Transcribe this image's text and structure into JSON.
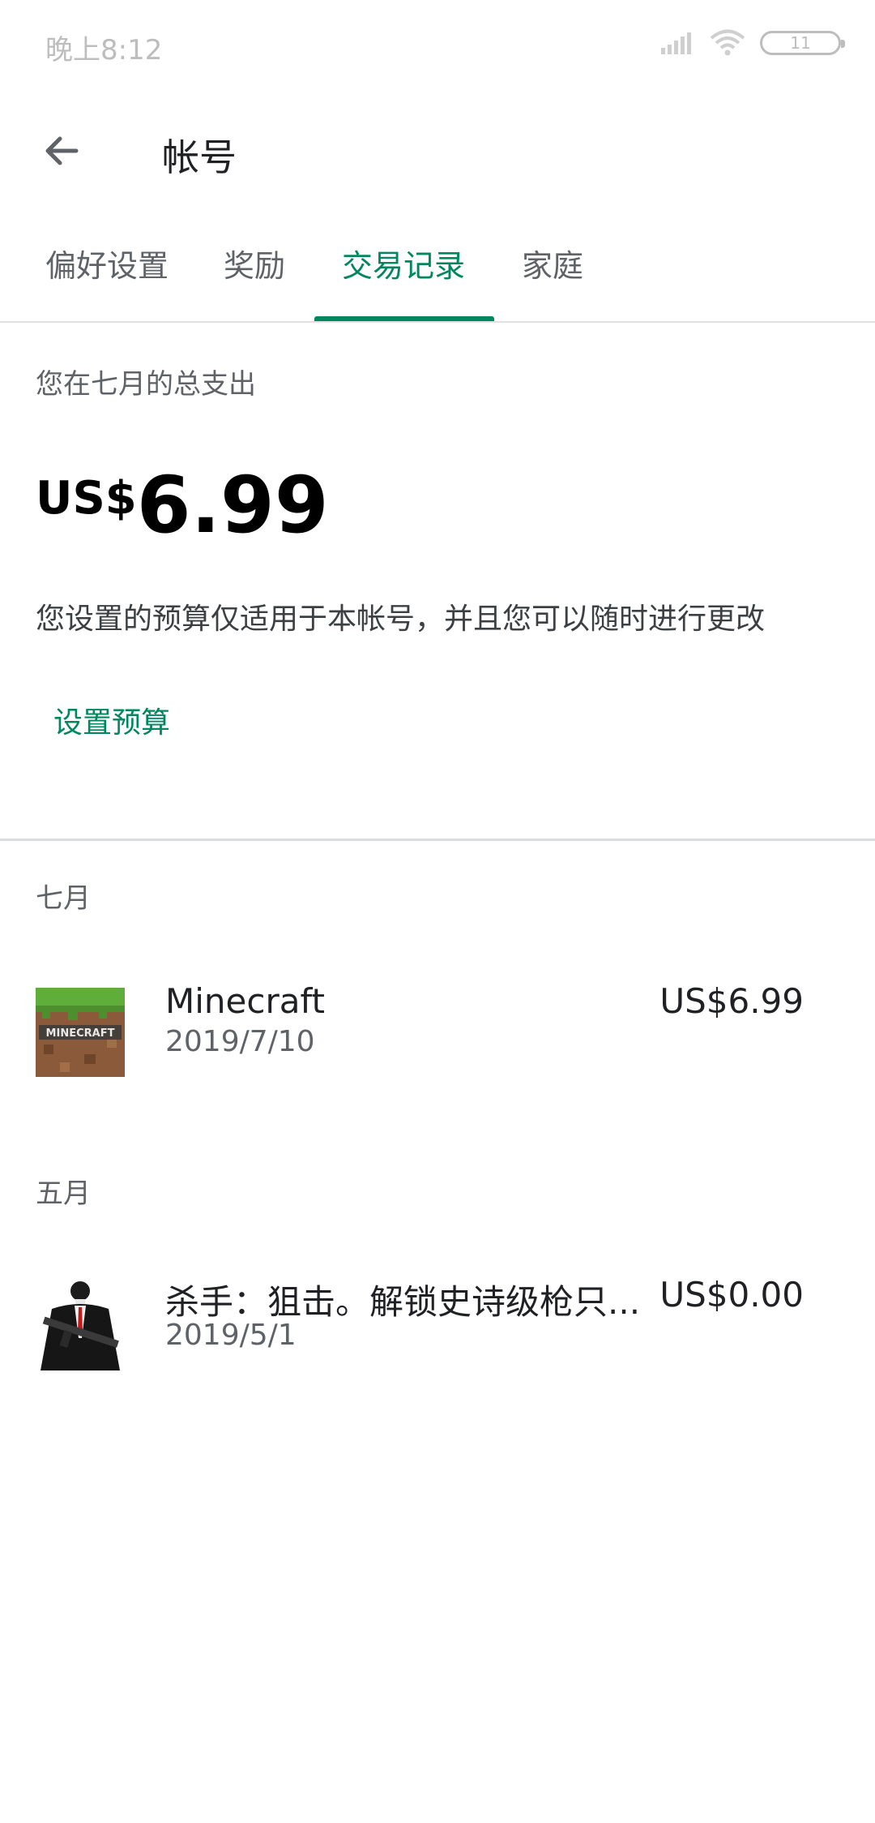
{
  "status_bar": {
    "time": "晚上8:12",
    "battery": "11"
  },
  "app_bar": {
    "title": "帐号",
    "back_icon": "arrow-back-icon"
  },
  "tabs": [
    {
      "label": "偏好设置"
    },
    {
      "label": "奖励"
    },
    {
      "label": "交易记录",
      "active": true
    },
    {
      "label": "家庭"
    }
  ],
  "summary": {
    "label": "您在七月的总支出",
    "currency": "US$",
    "amount": "6.99",
    "note": "您设置的预算仅适用于本帐号，并且您可以随时进行更改",
    "set_budget": "设置预算"
  },
  "sections": [
    {
      "month": "七月",
      "items": [
        {
          "name": "Minecraft",
          "date": "2019/7/10",
          "price": "US$6.99",
          "icon": "minecraft-app-icon",
          "icon_text": "MINECRAFT"
        }
      ]
    },
    {
      "month": "五月",
      "items": [
        {
          "name": "杀手：狙击。解锁史诗级枪只...",
          "date": "2019/5/1",
          "price": "US$0.00",
          "icon": "hitman-sniper-app-icon"
        }
      ]
    }
  ],
  "colors": {
    "accent": "#01875f",
    "text_primary": "#202124",
    "text_secondary": "#5f6368"
  }
}
